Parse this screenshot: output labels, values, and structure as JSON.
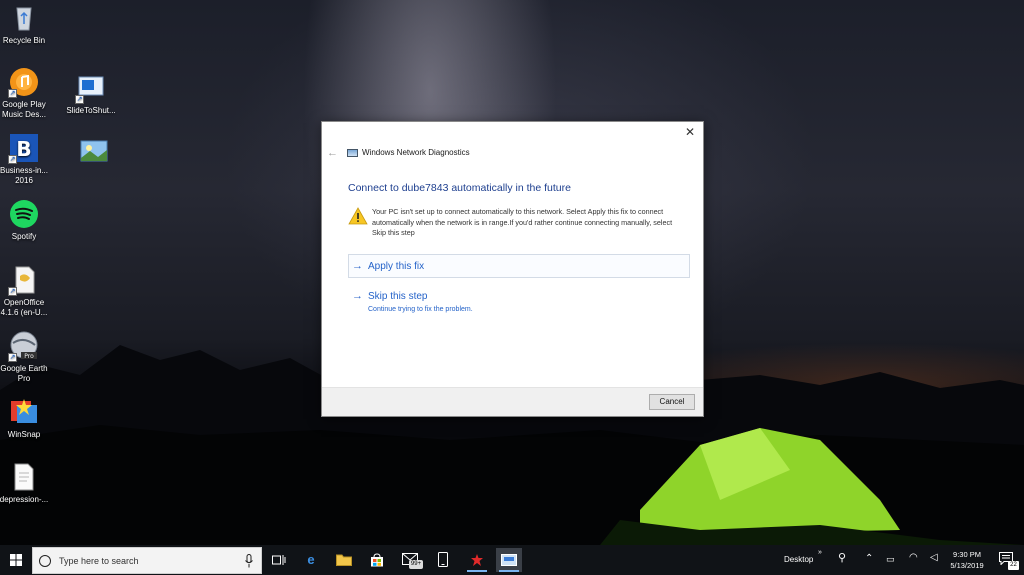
{
  "desktop": {
    "icons": [
      {
        "label": "Recycle Bin"
      },
      {
        "label": "Google Play Music Des..."
      },
      {
        "label": "SlideToShut..."
      },
      {
        "label": "Business-in... 2016"
      },
      {
        "label": "Spotify"
      },
      {
        "label": "OpenOffice 4.1.6 (en-U..."
      },
      {
        "label": "Google Earth Pro"
      },
      {
        "label": "WinSnap"
      },
      {
        "label": "depression-..."
      }
    ]
  },
  "dialog": {
    "title": "Windows Network Diagnostics",
    "heading": "Connect to dube7843 automatically in the future",
    "message": "Your PC isn't set up to connect automatically to this network. Select Apply this fix to connect automatically when the network is in range.If you'd rather continue connecting manually, select Skip this step",
    "apply_label": "Apply this fix",
    "skip_label": "Skip this step",
    "skip_sub": "Continue trying to fix the problem.",
    "cancel_label": "Cancel"
  },
  "taskbar": {
    "search_placeholder": "Type here to search",
    "store_badge": "99+",
    "desktop_label": "Desktop",
    "time": "9:30 PM",
    "date": "5/13/2019",
    "notification_count": "22"
  },
  "colors": {
    "accent": "#2563c9",
    "heading": "#1e3f8f",
    "taskbar": "#101317"
  }
}
